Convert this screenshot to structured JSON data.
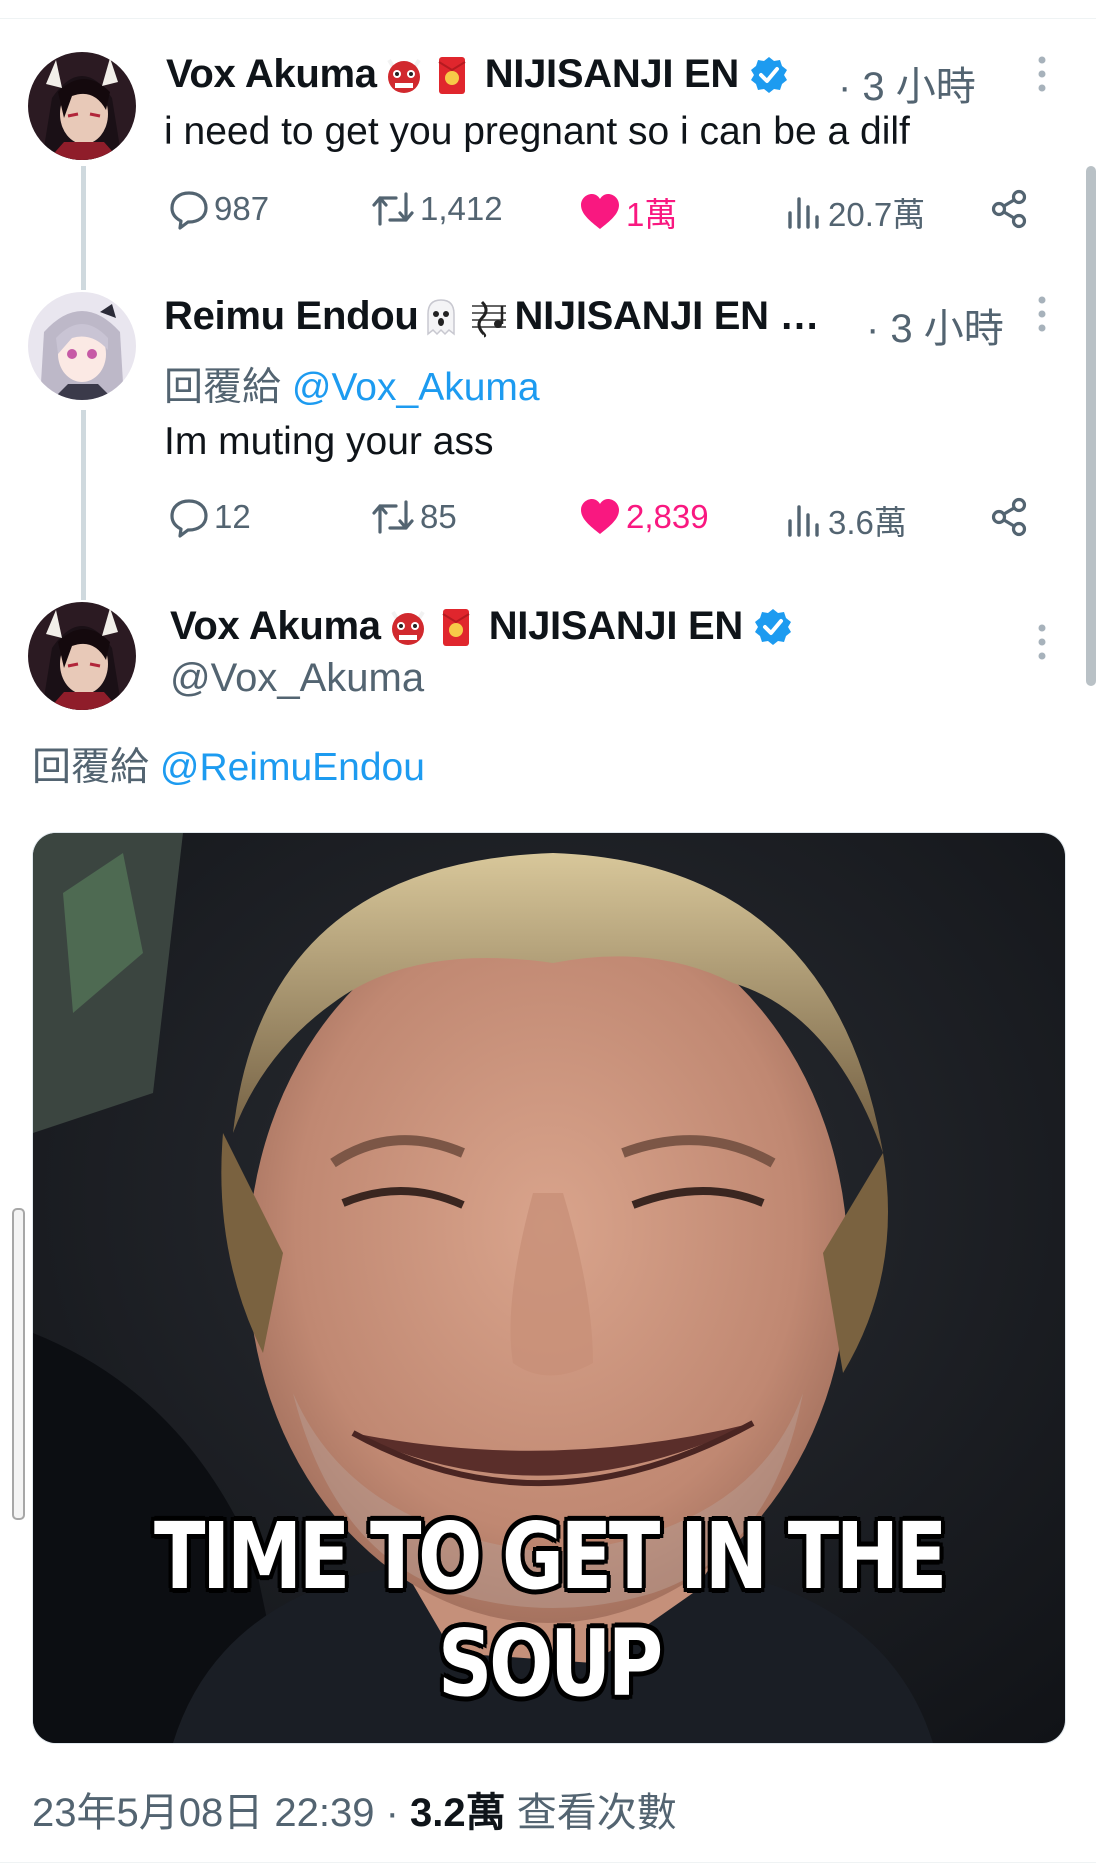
{
  "tweets": [
    {
      "author": "Vox Akuma",
      "affiliation": "NIJISANJI EN",
      "time": "· 3 小時",
      "text": "i need to get you pregnant so i can be a dilf",
      "replies": "987",
      "retweets": "1,412",
      "likes": "1萬",
      "views": "20.7萬"
    },
    {
      "author": "Reimu Endou",
      "affiliation": "NIJISANJI EN …",
      "time": "· 3 小時",
      "reply_prefix": "回覆給",
      "reply_to": "@Vox_Akuma",
      "text": "Im muting your ass",
      "replies": "12",
      "retweets": "85",
      "likes": "2,839",
      "views": "3.6萬"
    }
  ],
  "main_tweet": {
    "author": "Vox Akuma",
    "affiliation": "NIJISANJI EN",
    "handle": "@Vox_Akuma",
    "reply_prefix": "回覆給",
    "reply_to": "@ReimuEndou",
    "image_caption": "TIME TO GET IN THE SOUP",
    "timestamp": "23年5月08日 22:39",
    "separator": " · ",
    "views_count": "3.2萬",
    "views_label": "查看次數"
  },
  "icons": {
    "reply": "reply-icon",
    "retweet": "retweet-icon",
    "like": "heart-icon",
    "views": "views-icon",
    "share": "share-icon",
    "more": "more-icon",
    "verified": "verified-badge-icon"
  },
  "colors": {
    "accent": "#1d9bf0",
    "like": "#f91880",
    "muted": "#536471",
    "text": "#0f1419"
  }
}
